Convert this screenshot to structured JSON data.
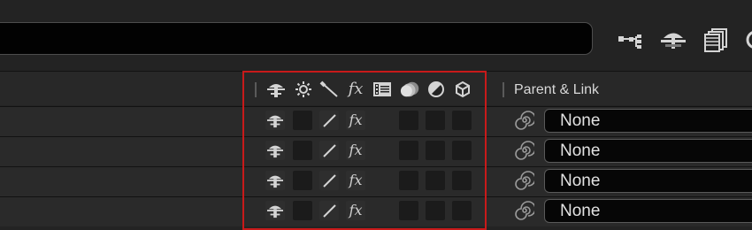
{
  "search": {
    "value": "",
    "placeholder": ""
  },
  "toolbar": {
    "icons": [
      "composition-flowchart-icon",
      "shy-layers-icon",
      "frame-blending-icon",
      "motion-blur-icon"
    ]
  },
  "switches_header": {
    "icons": [
      "shy-icon",
      "collapse-transformations-icon",
      "quality-icon",
      "effect-icon",
      "frame-blending-icon",
      "motion-blur-icon",
      "adjustment-layer-icon",
      "3d-layer-icon"
    ],
    "fx_label": "fx"
  },
  "parent_link": {
    "header": "Parent & Link"
  },
  "layers": [
    {
      "fx": "fx",
      "parent": "None"
    },
    {
      "fx": "fx",
      "parent": "None"
    },
    {
      "fx": "fx",
      "parent": "None"
    },
    {
      "fx": "fx",
      "parent": "None"
    }
  ],
  "colors": {
    "highlight_border": "#c81a1a",
    "background": "#232323",
    "row": "#2a2a2a"
  }
}
